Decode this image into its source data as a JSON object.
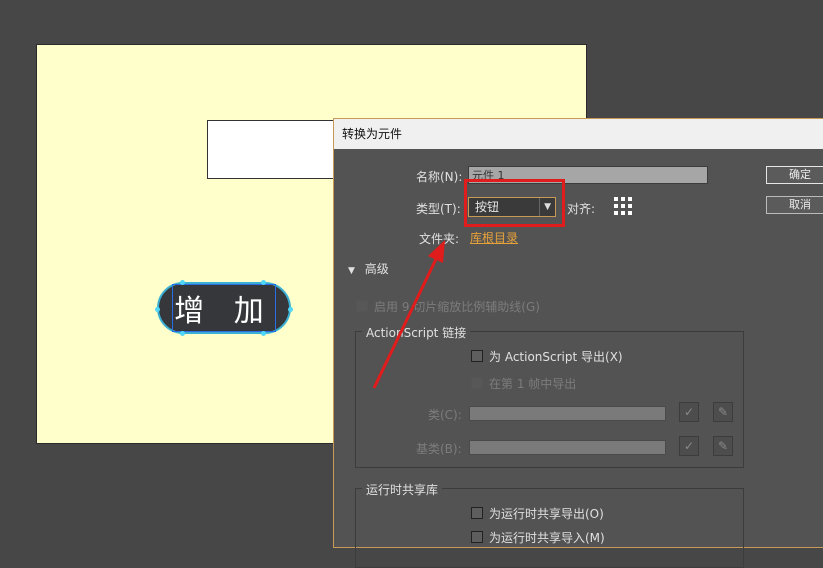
{
  "stage": {
    "button_text": "增 加"
  },
  "dialog": {
    "title": "转换为元件",
    "name_label": "名称(N):",
    "name_value": "元件 1",
    "type_label": "类型(T):",
    "type_value": "按钮",
    "align_label": "对齐:",
    "folder_label": "文件夹:",
    "folder_value": "库根目录",
    "ok_label": "确定",
    "cancel_label": "取消",
    "advanced_label": "高级",
    "nine_slice_label": "启用 9 切片缩放比例辅助线(G)",
    "actionscript_group": "ActionScript 链接",
    "export_as_label": "为 ActionScript 导出(X)",
    "export_frame1_label": "在第 1 帧中导出",
    "class_label": "类(C):",
    "base_class_label": "基类(B):",
    "runtime_group": "运行时共享库",
    "runtime_export_label": "为运行时共享导出(O)",
    "runtime_import_label": "为运行时共享导入(M)"
  },
  "colors": {
    "highlight_box": "#e01c1c",
    "annotation_arrow": "#e01c1c",
    "folder_link": "#e8a23a",
    "stage_bg": "#ffffcc",
    "dialog_bg": "#535353"
  }
}
